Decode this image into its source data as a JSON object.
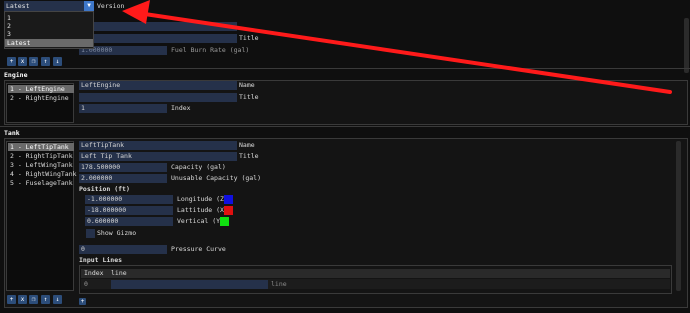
{
  "version": {
    "selected": "Latest",
    "label": "Version",
    "options": [
      "1",
      "2",
      "3",
      "Latest"
    ]
  },
  "top_section": {
    "title_label": "Title",
    "fuel_burn_value": "1.000000",
    "fuel_burn_label": "Fuel Burn Rate (gal)"
  },
  "engine": {
    "header": "Engine",
    "items": [
      "1 - LeftEngine",
      "2 - RightEngine"
    ],
    "name_value": "LeftEngine",
    "name_label": "Name",
    "title_value": "",
    "title_label": "Title",
    "index_value": "1",
    "index_label": "Index"
  },
  "tank": {
    "header": "Tank",
    "items": [
      "1 - LeftTipTank",
      "2 - RightTipTank",
      "3 - LeftWingTank",
      "4 - RightWingTank",
      "5 - FuselageTank"
    ],
    "name_value": "LeftTipTank",
    "name_label": "Name",
    "title_value": "Left Tip Tank",
    "title_label": "Title",
    "capacity_value": "178.500000",
    "capacity_label": "Capacity (gal)",
    "unusable_value": "2.000000",
    "unusable_label": "Unusable Capacity (gal)",
    "position_header": "Position (ft)",
    "longitude_value": "-1.000000",
    "longitude_label": "Longitude (Z)",
    "latitude_value": "-18.000000",
    "latitude_label": "Lattitude (X)",
    "vertical_value": "0.600000",
    "vertical_label": "Vertical (Y)",
    "show_gizmo_label": "Show Gizmo",
    "pressure_value": "0",
    "pressure_label": "Pressure Curve",
    "input_lines_header": "Input Lines",
    "table_headers": [
      "Index",
      "line"
    ],
    "table_row": {
      "index": "0",
      "line_placeholder": "line"
    }
  },
  "buttons": {
    "add": "+",
    "remove": "x",
    "copy": "❐",
    "up": "↑",
    "down": "↓"
  },
  "colors": {
    "accent": "#2c4d7a",
    "field": "#25314a",
    "longitude_swatch": "#1010e0",
    "latitude_swatch": "#e01010",
    "vertical_swatch": "#10e010",
    "arrow": "#ff1a1a"
  }
}
